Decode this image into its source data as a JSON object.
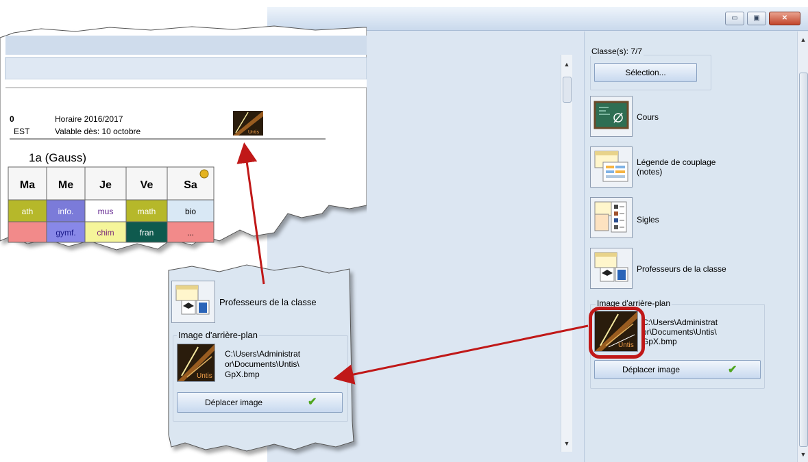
{
  "window": {
    "controls": [
      "minimize",
      "maximize",
      "close"
    ],
    "min_icon": "▭",
    "max_icon": "▣",
    "close_icon": "✕"
  },
  "right_panel": {
    "classes_label": "Classe(s): 7/7",
    "selection_button": "Sélection...",
    "options": [
      {
        "label": "Cours",
        "icon": "chalkboard-icon"
      },
      {
        "label": "Légende de couplage\n(notes)",
        "icon": "coupling-legend-icon"
      },
      {
        "label": "Sigles",
        "icon": "abbreviations-icon"
      },
      {
        "label": "Professeurs de la classe",
        "icon": "class-teachers-icon"
      }
    ],
    "background": {
      "legend": "Image d'arrière-plan",
      "path": "C:\\Users\\Administrat\nor\\Documents\\Untis\\\nGpX.bmp",
      "move_button": "Déplacer image"
    }
  },
  "callout": {
    "option_label": "Professeurs de la classe",
    "background": {
      "legend": "Image d'arrière-plan",
      "path": "C:\\Users\\Administrat\nor\\Documents\\Untis\\\nGpX.bmp",
      "move_button": "Déplacer image"
    }
  },
  "timetable_preview": {
    "header_partial": "0",
    "school_partial": "EST",
    "schedule": "Horaire 2016/2017",
    "valid_from": "Valable dès: 10 octobre",
    "logo_text": "Untis",
    "class_title": "1a (Gauss)",
    "days": [
      "Ma",
      "Me",
      "Je",
      "Ve",
      "Sa"
    ],
    "row1": [
      "ath",
      "info.",
      "mus",
      "math",
      "bio"
    ],
    "row2": [
      "",
      "gymf.",
      "chim",
      "fran",
      "..."
    ]
  },
  "colors": {
    "accent_red": "#c01818",
    "panel_bg": "#dbe6f1",
    "math": "#b6b82a",
    "info": "#7b7bd9",
    "gymf": "#8888e8",
    "chim": "#f5f59a",
    "fran": "#0f5a4e",
    "bio_bg": "#d9e8f5",
    "row2_red": "#f28a8a"
  }
}
